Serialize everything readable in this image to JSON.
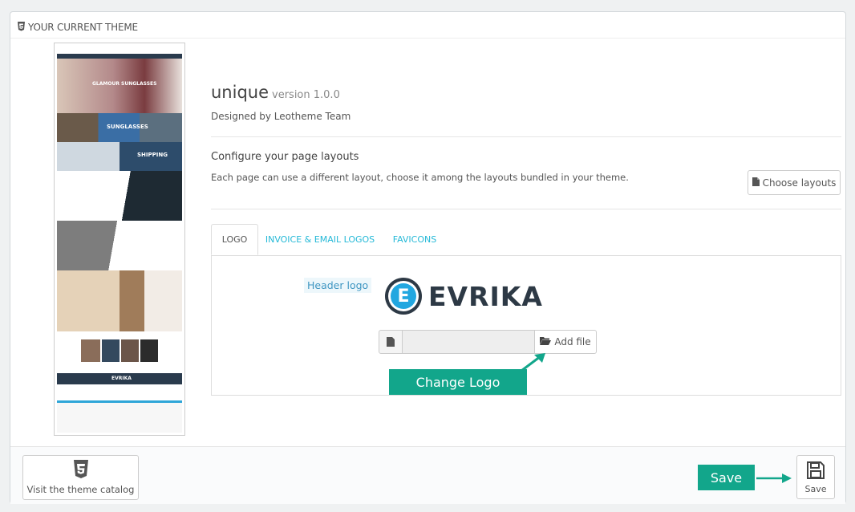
{
  "panel": {
    "heading": "YOUR CURRENT THEME"
  },
  "theme": {
    "name": "unique",
    "version": "version 1.0.0",
    "designed_by": "Designed by Leotheme Team"
  },
  "layouts": {
    "title": "Configure your page layouts",
    "description": "Each page can use a different layout, choose it among the layouts bundled in your theme.",
    "button": "Choose layouts"
  },
  "tabs": [
    {
      "label": "LOGO",
      "active": true
    },
    {
      "label": "INVOICE & EMAIL LOGOS",
      "active": false
    },
    {
      "label": "FAVICONS",
      "active": false
    }
  ],
  "logo_tab": {
    "header_logo_label": "Header logo",
    "logo_text": "EVRIKA",
    "logo_letter": "E",
    "add_file": "Add file"
  },
  "thumbnail": {
    "banner1": "GLAMOUR SUNGLASSES",
    "banner2": "SUNGLASSES",
    "banner3": "SHIPPING",
    "footer_brand": "EVRIKA"
  },
  "annotations": {
    "change_logo": "Change Logo",
    "save": "Save"
  },
  "footer": {
    "catalog_button": "Visit the theme catalog",
    "save_button": "Save"
  },
  "colors": {
    "accent": "#25b9d7",
    "annotation": "#12a68b",
    "logo_blue": "#22a7e0",
    "logo_dark": "#2d3945"
  }
}
